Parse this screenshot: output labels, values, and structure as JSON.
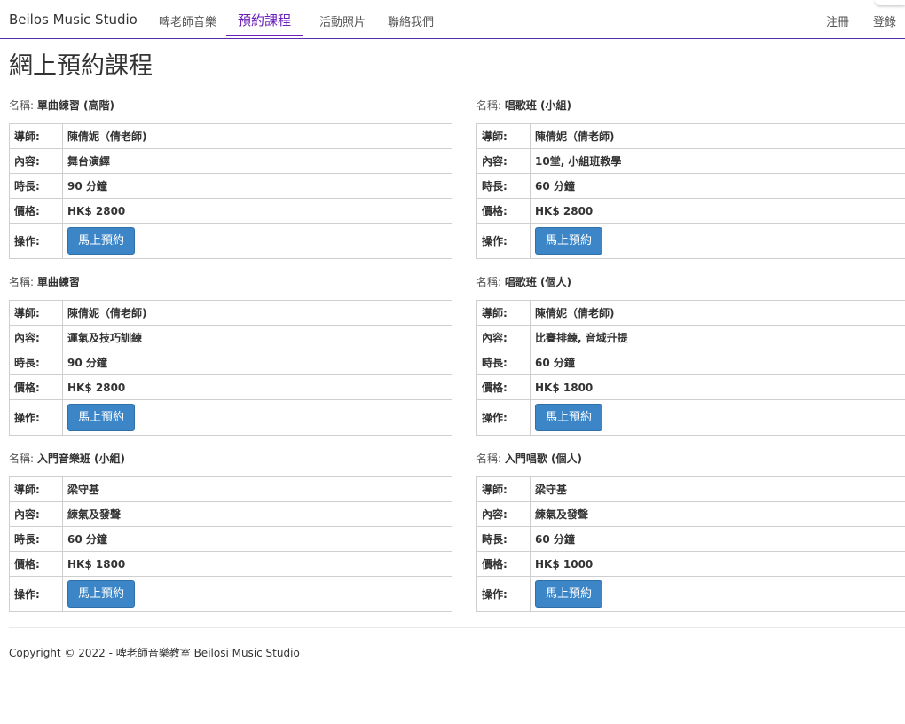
{
  "nav": {
    "brand": "Beilos Music Studio",
    "links": [
      "啤老師音樂",
      "預約課程",
      "活動照片",
      "聯絡我們"
    ],
    "right_links": [
      "注冊",
      "登錄"
    ],
    "active_index": 1,
    "accent_color": "#6a1fb8"
  },
  "page_title": "網上預約課程",
  "labels": {
    "name": "名稱:",
    "teacher": "導師:",
    "content": "內容:",
    "duration": "時長:",
    "price": "價格:",
    "action": "操作:",
    "book_button": "馬上預約"
  },
  "button_color": "#3c86c8",
  "courses": [
    {
      "name": "單曲練習 (高階)",
      "teacher": "陳倩妮（倩老師)",
      "content": "舞台演繹",
      "duration": "90 分鐘",
      "price": "HK$ 2800"
    },
    {
      "name": "唱歌班 (小組)",
      "teacher": "陳倩妮（倩老師)",
      "content": "10堂, 小組班教學",
      "duration": "60 分鐘",
      "price": "HK$ 2800"
    },
    {
      "name": "單曲練習",
      "teacher": "陳倩妮（倩老師)",
      "content": "運氣及技巧訓練",
      "duration": "90 分鐘",
      "price": "HK$ 2800"
    },
    {
      "name": "唱歌班 (個人)",
      "teacher": "陳倩妮（倩老師)",
      "content": "比賽排練, 音域升提",
      "duration": "60 分鐘",
      "price": "HK$ 1800"
    },
    {
      "name": "入門音樂班 (小組)",
      "teacher": "梁守基",
      "content": "練氣及發聲",
      "duration": "60 分鐘",
      "price": "HK$ 1800"
    },
    {
      "name": "入門唱歌 (個人)",
      "teacher": "梁守基",
      "content": "練氣及發聲",
      "duration": "60 分鐘",
      "price": "HK$ 1000"
    }
  ],
  "footer": {
    "copyright": "Copyright © 2022 - 啤老師音樂教室 Beilosi Music Studio"
  }
}
